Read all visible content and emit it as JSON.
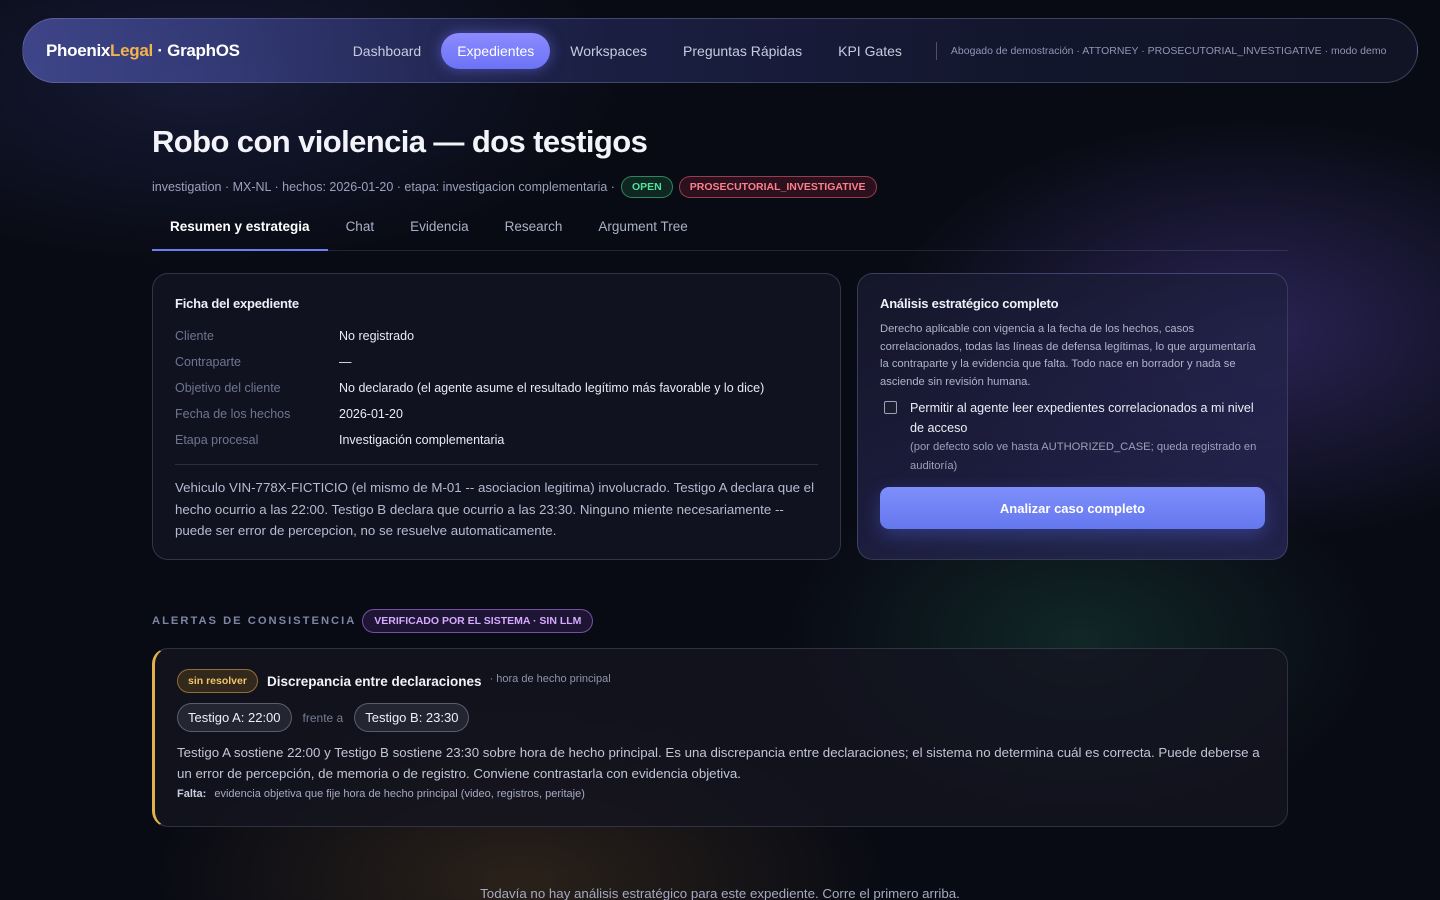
{
  "nav": {
    "brand_a": "Phoenix",
    "brand_b": "Legal",
    "brand_c": "· GraphOS",
    "links": [
      "Dashboard",
      "Expedientes",
      "Workspaces",
      "Preguntas Rápidas",
      "KPI Gates"
    ],
    "active": "Expedientes",
    "user": "Abogado de demostración · ATTORNEY · PROSECUTORIAL_INVESTIGATIVE · modo demo"
  },
  "case": {
    "title": "Robo con violencia — dos testigos",
    "meta": "investigation · MX-NL · hechos: 2026-01-20 · etapa: investigacion complementaria ·",
    "status": "OPEN",
    "role": "PROSECUTORIAL_INVESTIGATIVE"
  },
  "tabs": [
    "Resumen y estrategia",
    "Chat",
    "Evidencia",
    "Research",
    "Argument Tree"
  ],
  "ficha": {
    "heading": "Ficha del expediente",
    "rows": [
      {
        "label": "Cliente",
        "value": "No registrado"
      },
      {
        "label": "Contraparte",
        "value": "—"
      },
      {
        "label": "Objetivo del cliente",
        "value": "No declarado (el agente asume el resultado legítimo más favorable y lo dice)"
      },
      {
        "label": "Fecha de los hechos",
        "value": "2026-01-20"
      },
      {
        "label": "Etapa procesal",
        "value": "Investigación complementaria"
      }
    ],
    "description": "Vehiculo VIN-778X-FICTICIO (el mismo de M-01 -- asociacion legitima) involucrado. Testigo A declara que el hecho ocurrio a las 22:00. Testigo B declara que ocurrio a las 23:30. Ninguno miente necesariamente -- puede ser error de percepcion, no se resuelve automaticamente."
  },
  "analisis": {
    "heading": "Análisis estratégico completo",
    "description": "Derecho aplicable con vigencia a la fecha de los hechos, casos correlacionados, todas las líneas de defensa legítimas, lo que argumentaría la contraparte y la evidencia que falta. Todo nace en borrador y nada se asciende sin revisión humana.",
    "checkbox_label": "Permitir al agente leer expedientes correlacionados a mi nivel de acceso",
    "checkbox_note": "(por defecto solo ve hasta AUTHORIZED_CASE; queda registrado en auditoría)",
    "checkbox_checked": false,
    "button": "Analizar caso completo"
  },
  "alerts": {
    "title": "ALERTAS DE CONSISTENCIA",
    "badge": "VERIFICADO POR EL SISTEMA · SIN LLM",
    "items": [
      {
        "status": "sin resolver",
        "title": "Discrepancia entre declaraciones",
        "subtitle": "· hora de hecho principal",
        "left": "Testigo A: 22:00",
        "versus": "frente a",
        "right": "Testigo B: 23:30",
        "description": "Testigo A sostiene 22:00 y Testigo B sostiene 23:30 sobre hora de hecho principal. Es una discrepancia entre declaraciones; el sistema no determina cuál es correcta. Puede deberse a un error de percepción, de memoria o de registro. Conviene contrastarla con evidencia objetiva.",
        "falta_label": "Falta:",
        "falta_value": "evidencia objetiva que fije hora de hecho principal (video, registros, peritaje)"
      }
    ]
  },
  "footer": "Todavía no hay análisis estratégico para este expediente. Corre el primero arriba.",
  "colors": {
    "accent": "#6b73f5",
    "brand_legal": "#f2b24c",
    "open": "#4ee39a",
    "role": "#ff7d8e",
    "verified": "#d5a9ff",
    "unresolved": "#f0c56a"
  }
}
